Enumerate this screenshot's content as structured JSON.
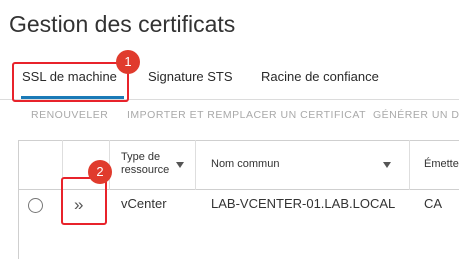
{
  "page": {
    "title": "Gestion des certificats"
  },
  "tabs": [
    {
      "label": "SSL de machine"
    },
    {
      "label": "Signature STS"
    },
    {
      "label": "Racine de confiance"
    }
  ],
  "actions": {
    "renew": "RENOUVELER",
    "import": "IMPORTER ET REMPLACER UN CERTIFICAT",
    "generate": "GÉNÉRER UN D"
  },
  "table": {
    "headers": {
      "type_line1": "Type de",
      "type_line2": "ressource",
      "common_name": "Nom commun",
      "issuer": "Émette"
    },
    "row": {
      "expand_glyph": "»",
      "type": "vCenter",
      "common_name": "LAB-VCENTER-01.LAB.LOCAL",
      "issuer": "CA"
    }
  },
  "annotations": {
    "badge1": "1",
    "badge2": "2",
    "color": "#e8232b"
  }
}
